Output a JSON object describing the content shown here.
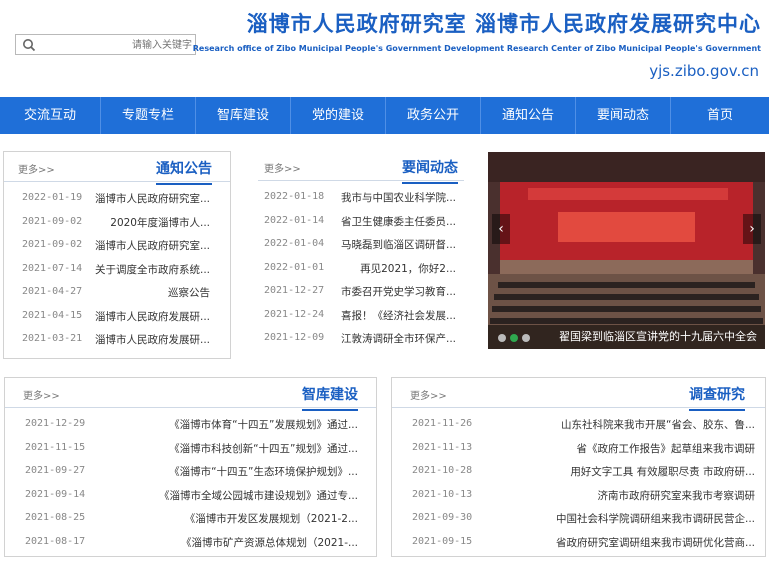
{
  "header": {
    "title_cn": "淄博市人民政府研究室  淄博市人民政府发展研究中心",
    "title_en": "Research office of Zibo Municipal People's Government    Development Research Center of Zibo Municipal People's Government",
    "domain": "yjs.zibo.gov.cn",
    "search_placeholder": "请输入关键字",
    "search_icon": "search-icon"
  },
  "colors": {
    "brand": "#1a5fc2",
    "nav_bg": "#1f6fd8",
    "dot_active": "#2fa84f"
  },
  "nav": {
    "items": [
      "首页",
      "要闻动态",
      "通知公告",
      "政务公开",
      "党的建设",
      "智库建设",
      "专题专栏",
      "交流互动"
    ]
  },
  "news": {
    "title": "要闻动态",
    "more": "更多>>",
    "items": [
      {
        "text": "我市与中国农业科学院...",
        "date": "2022-01-18"
      },
      {
        "text": "省卫生健康委主任委员...",
        "date": "2022-01-14"
      },
      {
        "text": "马晓磊到临淄区调研督...",
        "date": "2022-01-04"
      },
      {
        "text": "再见2021，你好2...",
        "date": "2022-01-01"
      },
      {
        "text": "市委召开党史学习教育...",
        "date": "2021-12-27"
      },
      {
        "text": "喜报！《经济社会发展...",
        "date": "2021-12-24"
      },
      {
        "text": "江敦涛调研全市环保产...",
        "date": "2021-12-09"
      }
    ]
  },
  "notice": {
    "title": "通知公告",
    "more": "更多>>",
    "items": [
      {
        "text": "淄博市人民政府研究室...",
        "date": "2022-01-19"
      },
      {
        "text": "2020年度淄博市人...",
        "date": "2021-09-02"
      },
      {
        "text": "淄博市人民政府研究室...",
        "date": "2021-09-02"
      },
      {
        "text": "关于调度全市政府系统...",
        "date": "2021-07-14"
      },
      {
        "text": "巡察公告",
        "date": "2021-04-27"
      },
      {
        "text": "淄博市人民政府发展研...",
        "date": "2021-04-15"
      },
      {
        "text": "淄博市人民政府发展研...",
        "date": "2021-03-21"
      }
    ]
  },
  "carousel": {
    "caption": "翟国梁到临淄区宣讲党的十九届六中全会",
    "prev_icon": "chevron-left-icon",
    "next_icon": "chevron-right-icon",
    "dots": 3,
    "active_dot": 1
  },
  "research": {
    "title": "调查研究",
    "more": "更多>>",
    "items": [
      {
        "text": "山东社科院来我市开展“省会、胶东、鲁...",
        "date": "2021-11-26"
      },
      {
        "text": "省《政府工作报告》起草组来我市调研",
        "date": "2021-11-13"
      },
      {
        "text": "用好文字工具 有效履职尽责 市政府研...",
        "date": "2021-10-28"
      },
      {
        "text": "济南市政府研究室来我市考察调研",
        "date": "2021-10-13"
      },
      {
        "text": "中国社会科学院调研组来我市调研民营企...",
        "date": "2021-09-30"
      },
      {
        "text": "省政府研究室调研组来我市调研优化营商...",
        "date": "2021-09-15"
      }
    ]
  },
  "thinktank": {
    "title": "智库建设",
    "more": "更多>>",
    "items": [
      {
        "text": "《淄博市体育“十四五”发展规划》通过...",
        "date": "2021-12-29"
      },
      {
        "text": "《淄博市科技创新“十四五”规划》通过...",
        "date": "2021-11-15"
      },
      {
        "text": "《淄博市“十四五”生态环境保护规划》...",
        "date": "2021-09-27"
      },
      {
        "text": "《淄博市全域公园城市建设规划》通过专...",
        "date": "2021-09-14"
      },
      {
        "text": "《淄博市开发区发展规划（2021-2...",
        "date": "2021-08-25"
      },
      {
        "text": "《淄博市矿产资源总体规划（2021-...",
        "date": "2021-08-17"
      }
    ]
  }
}
